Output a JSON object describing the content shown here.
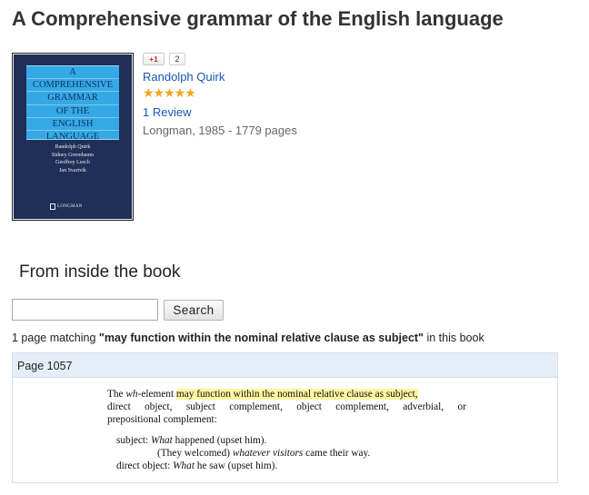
{
  "page_title": "A Comprehensive grammar of the English language",
  "cover": {
    "title_lines": [
      "A",
      "COMPREHENSIVE",
      "GRAMMAR",
      "OF THE",
      "ENGLISH",
      "LANGUAGE"
    ],
    "authors": [
      "Randolph Quirk",
      "Sidney Greenbaum",
      "Geoffrey Leech",
      "Jan Svartvik"
    ],
    "publisher": "LONGMAN",
    "colors": {
      "background": "#1f2f57",
      "title_band": "#35a9e6"
    }
  },
  "book": {
    "gplus_label": "+1",
    "gplus_count": "2",
    "author": "Randolph Quirk",
    "rating_stars": "★★★★★",
    "rating_value": 5,
    "reviews": "1 Review",
    "meta": "Longman, 1985 - 1779 pages"
  },
  "search": {
    "section_title": "From inside the book",
    "input_value": "",
    "button_label": "Search",
    "match_prefix": "1 page matching ",
    "match_query": "\"may function within the nominal relative clause as subject\"",
    "match_suffix": " in this book"
  },
  "result": {
    "page_label": "Page 1057",
    "snippet": {
      "l1_pre": "The ",
      "l1_wh": "wh",
      "l1_mid": "-element ",
      "l1_highlight": "may function within the nominal relative clause as subject,",
      "l2": [
        "direct",
        "object,",
        "subject",
        "complement,",
        "object",
        "complement,",
        "adverbial,",
        "or"
      ],
      "l3": "prepositional complement:",
      "ex1_label": "subject: ",
      "ex1_italic": "What",
      "ex1_rest": " happened (upset him).",
      "ex2_pre": "(They welcomed) ",
      "ex2_italic": "whatever visitors",
      "ex2_rest": " came their way.",
      "ex3_label": "direct object: ",
      "ex3_italic": "What",
      "ex3_rest": " he saw (upset him)."
    }
  },
  "colors": {
    "link": "#1a56b2",
    "stars": "#f3a71b",
    "highlight": "#fdf6a0",
    "result_header": "#e5edf9"
  }
}
